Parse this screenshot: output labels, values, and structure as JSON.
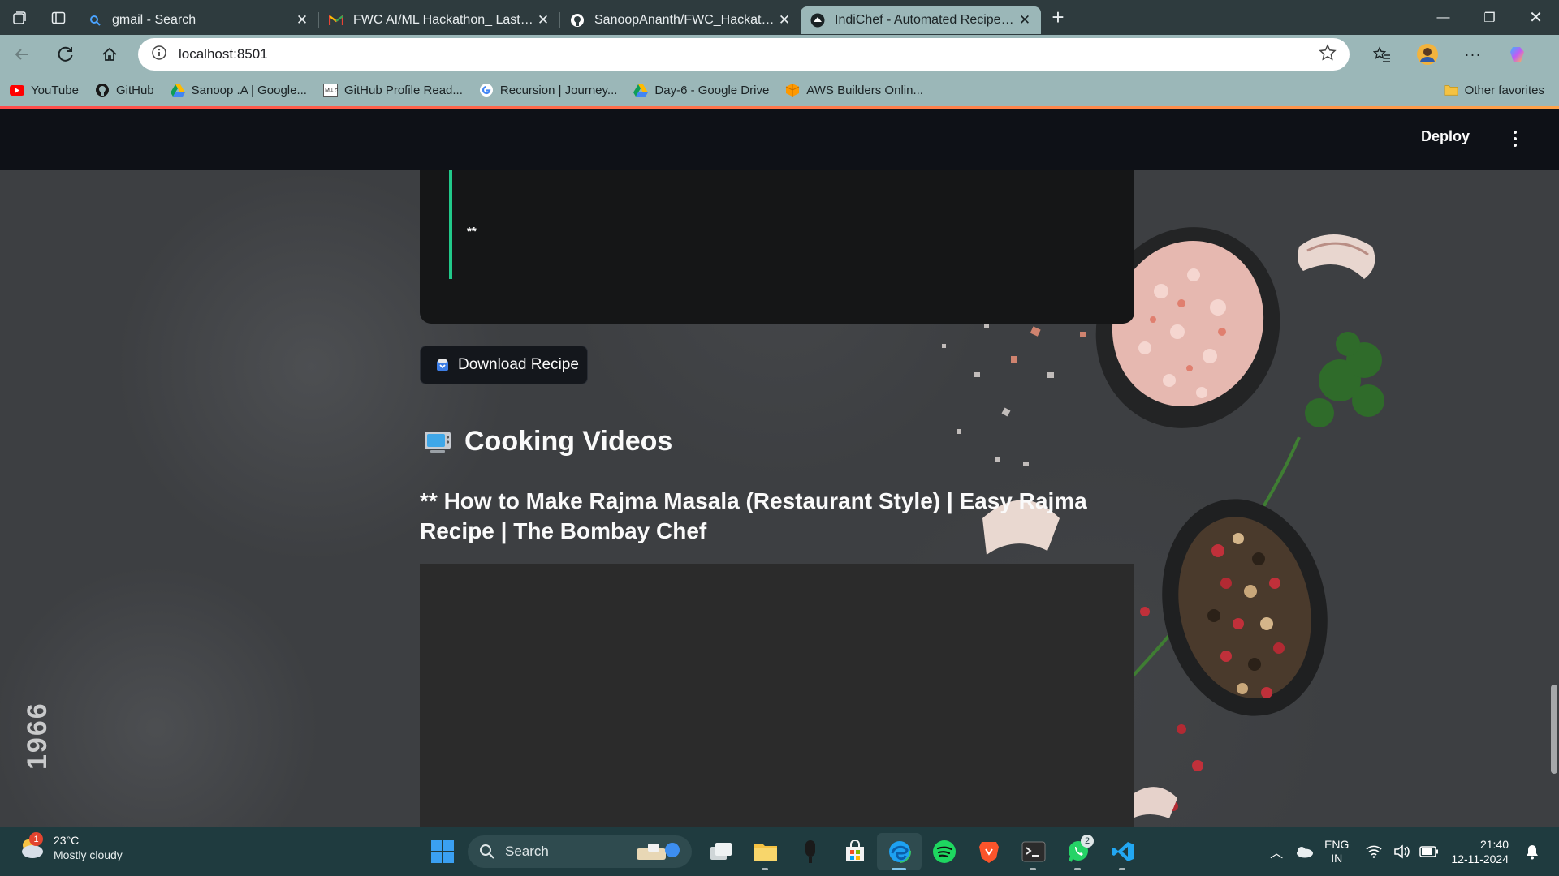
{
  "browser": {
    "tabs": [
      {
        "title": "gmail - Search",
        "icon": "search-icon",
        "active": false
      },
      {
        "title": "FWC AI/ML Hackathon_ Last date",
        "icon": "gmail-icon",
        "active": false
      },
      {
        "title": "SanoopAnanth/FWC_Hackathon",
        "icon": "github-icon",
        "active": false
      },
      {
        "title": "IndiChef - Automated Recipe Gen",
        "icon": "streamlit-icon",
        "active": true
      }
    ],
    "new_tab": "+",
    "url": "localhost:8501",
    "bookmarks": [
      {
        "label": "YouTube",
        "icon": "youtube-icon",
        "color": "#ff0000"
      },
      {
        "label": "GitHub",
        "icon": "github-icon",
        "color": "#181717"
      },
      {
        "label": "Sanoop .A | Google...",
        "icon": "google-drive-icon",
        "color": "#4285f4"
      },
      {
        "label": "GitHub Profile Read...",
        "icon": "readme-icon",
        "color": "#555555"
      },
      {
        "label": "Recursion | Journey...",
        "icon": "google-icon",
        "color": "#4285f4"
      },
      {
        "label": "Day-6 - Google Drive",
        "icon": "google-drive-icon",
        "color": "#0f9d58"
      },
      {
        "label": "AWS Builders Onlin...",
        "icon": "aws-icon",
        "color": "#ff9900"
      }
    ],
    "other_favorites": "Other favorites"
  },
  "app": {
    "deploy_label": "Deploy",
    "recipe_quote_text": "**",
    "download_button": "Download Recipe",
    "cooking_videos_heading": "Cooking Videos",
    "video_title": "** How to Make Rajma Masala (Restaurant Style) | Easy Rajma Recipe | The Bombay Chef",
    "watermark_text": "1966",
    "accent_color": "#21c98a"
  },
  "taskbar": {
    "weather_temp": "23°C",
    "weather_desc": "Mostly cloudy",
    "weather_badge": "1",
    "search_placeholder": "Search",
    "whatsapp_badge": "2",
    "lang_line1": "ENG",
    "lang_line2": "IN",
    "time": "21:40",
    "date": "12-11-2024"
  }
}
